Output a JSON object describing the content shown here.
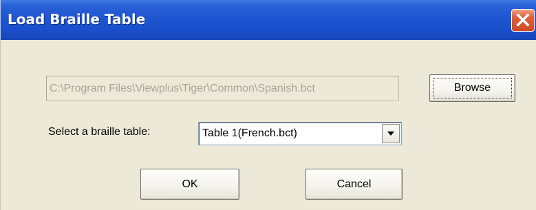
{
  "window": {
    "title": "Load Braille Table",
    "close_icon": "close-x-icon"
  },
  "file": {
    "path_value": "C:\\Program Files\\Viewplus\\Tiger\\Common\\Spanish.bct",
    "browse_label": "Browse"
  },
  "table_select": {
    "label": "Select a braille table:",
    "selected_value": "Table 1(French.bct)",
    "arrow_icon": "chevron-down-icon"
  },
  "actions": {
    "ok_label": "OK",
    "cancel_label": "Cancel"
  },
  "colors": {
    "titlebar": "#1f55cf",
    "dialog_background": "#ece9d8",
    "close_button": "#e0603a"
  }
}
